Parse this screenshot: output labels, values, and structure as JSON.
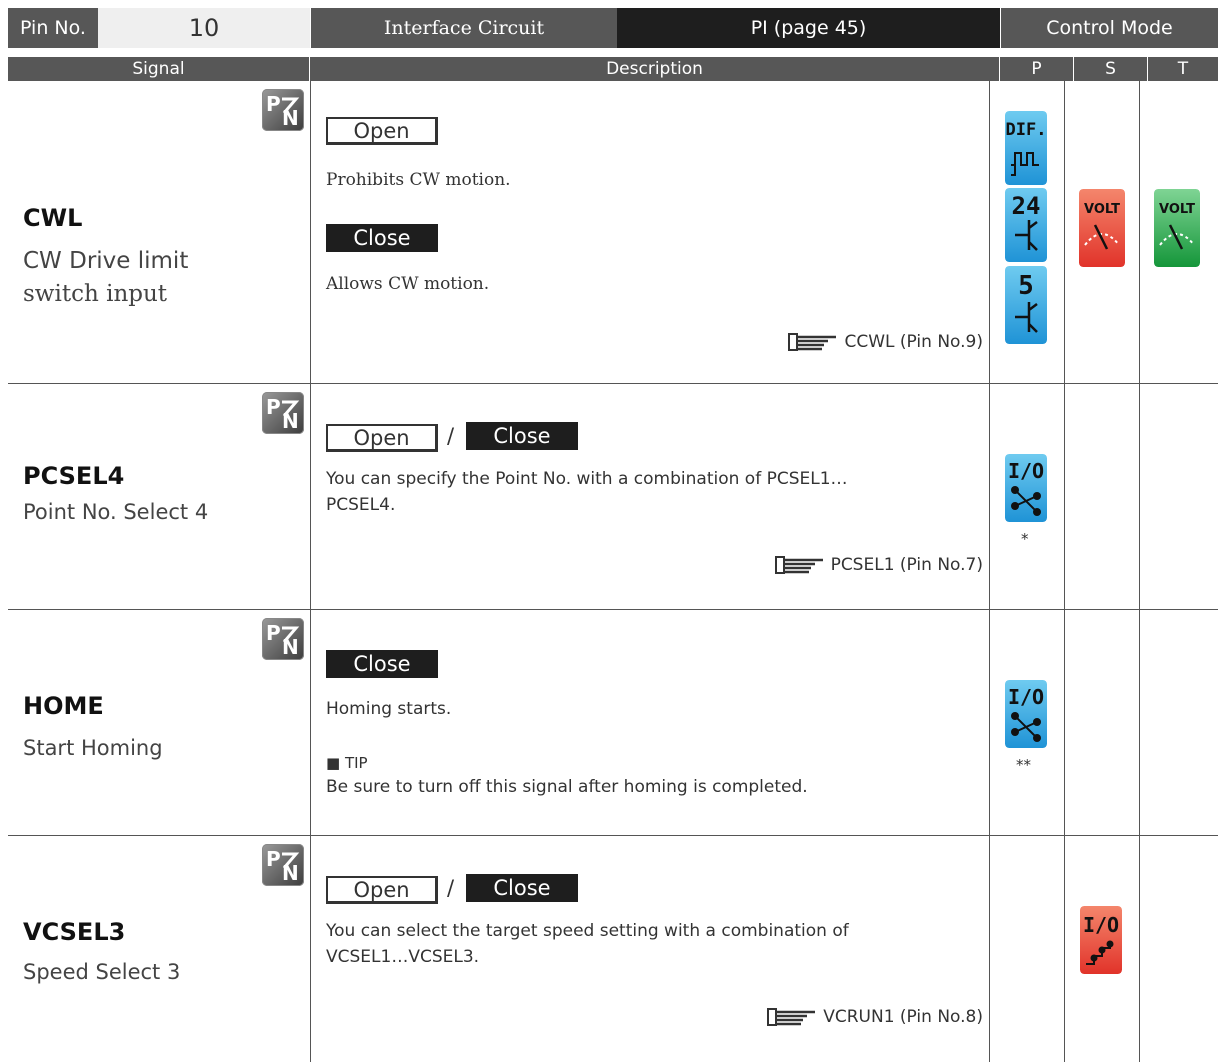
{
  "header": {
    "pin_label": "Pin No.",
    "pin_value": "10",
    "interface_label": "Interface Circuit",
    "interface_value": "PI  (page 45)",
    "control_mode_label": "Control Mode",
    "col_signal": "Signal",
    "col_description": "Description",
    "col_p": "P",
    "col_s": "S",
    "col_t": "T"
  },
  "rows": [
    {
      "name": "CWL",
      "desc_line1": "CW Drive limit",
      "desc_line2": "switch input",
      "open_label": "Open",
      "open_text": "Prohibits CW motion.",
      "close_label": "Close",
      "close_text": "Allows CW motion.",
      "ref": "CCWL  (Pin No.9)",
      "p_icons": [
        "DIF.",
        "24",
        "5"
      ],
      "s_icon": "VOLT",
      "t_icon": "VOLT"
    },
    {
      "name": "PCSEL4",
      "desc_line1": "Point No. Select 4",
      "open_label": "Open",
      "slash": "/",
      "close_label": "Close",
      "text_line1": "You can specify the Point No. with a combination of PCSEL1…",
      "text_line2": "PCSEL4.",
      "ref": "PCSEL1  (Pin No.7)",
      "p_icon": "I/O",
      "p_note": "*"
    },
    {
      "name": "HOME",
      "desc_line1": "Start Homing",
      "close_label": "Close",
      "text": "Homing starts.",
      "tip_label": "■ TIP",
      "tip_text": "Be sure to turn off this signal after homing is completed.",
      "p_icon": "I/O",
      "p_note": "**"
    },
    {
      "name": "VCSEL3",
      "desc_line1": "Speed Select 3",
      "open_label": "Open",
      "slash": "/",
      "close_label": "Close",
      "text_line1": "You can select the target speed setting with a combination of",
      "text_line2": "VCSEL1…VCSEL3.",
      "ref": "VCRUN1  (Pin No.8)",
      "s_icon": "I/O"
    }
  ],
  "colors": {
    "header_dark": "#575757",
    "header_black": "#1e1e1e",
    "header_light": "#efefef",
    "icon_blue": "#2aa6e0",
    "icon_red": "#e64a2e",
    "icon_green": "#27a84a"
  }
}
